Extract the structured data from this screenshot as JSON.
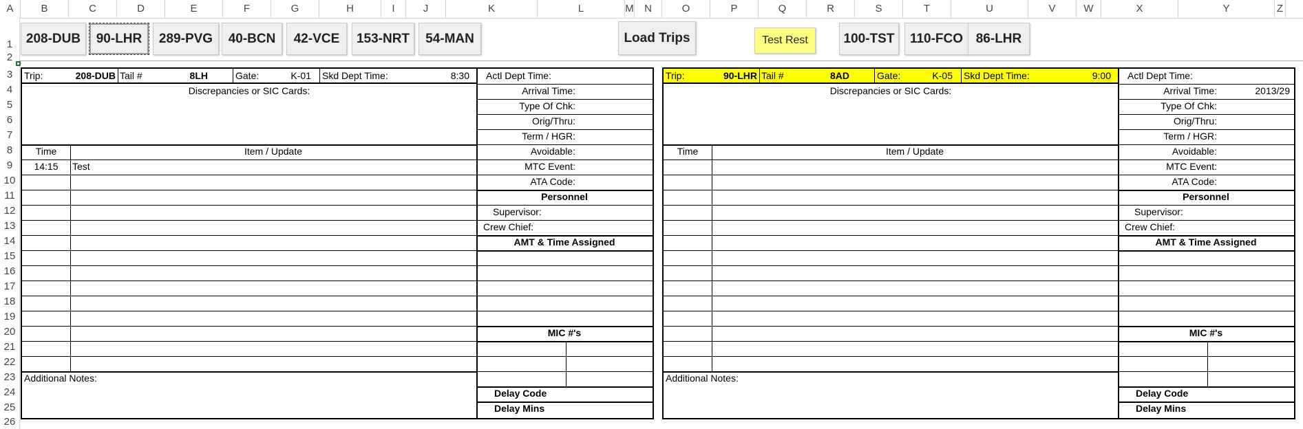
{
  "sheet": {
    "columns": [
      "A",
      "B",
      "C",
      "D",
      "E",
      "F",
      "G",
      "H",
      "I",
      "J",
      "K",
      "L",
      "M",
      "N",
      "O",
      "P",
      "Q",
      "R",
      "S",
      "T",
      "U",
      "V",
      "W",
      "X",
      "Y",
      "Z"
    ],
    "rows": [
      "1",
      "2",
      "3",
      "4",
      "5",
      "6",
      "7",
      "8",
      "9",
      "10",
      "11",
      "12",
      "13",
      "14",
      "15",
      "16",
      "17",
      "18",
      "19",
      "20",
      "21",
      "22",
      "23",
      "24",
      "25",
      "26"
    ]
  },
  "buttons": {
    "b1": "208-DUB",
    "b2": "90-LHR",
    "b3": "289-PVG",
    "b4": "40-BCN",
    "b5": "42-VCE",
    "b6": "153-NRT",
    "b7": "54-MAN",
    "load": "Load Trips",
    "test": "Test Rest",
    "b8": "100-TST",
    "b9": "110-FCO",
    "b10": "86-LHR"
  },
  "colors": {
    "highlight": "#ffff00",
    "grid": "#d4d4d4",
    "excel_green": "#217346"
  },
  "left": {
    "trip_label": "Trip:",
    "trip": "208-DUB",
    "tail_label": "Tail #",
    "tail": "8LH",
    "gate_label": "Gate:",
    "gate": "K-01",
    "skd_label": "Skd Dept Time:",
    "skd": "8:30",
    "actl_label": "Actl Dept Time:",
    "arrival_label": "Arrival Time:",
    "arrival": "",
    "type_label": "Type Of Chk:",
    "orig_label": "Orig/Thru:",
    "term_label": "Term / HGR:",
    "avoid_label": "Avoidable:",
    "mtc_label": "MTC Event:",
    "ata_label": "ATA Code:",
    "personnel": "Personnel",
    "supervisor_label": "Supervisor:",
    "crew_label": "Crew Chief:",
    "amt": "AMT & Time Assigned",
    "mic": "MIC #'s",
    "delay_code": "Delay Code",
    "delay_mins": "Delay Mins",
    "disc": "Discrepancies or SIC Cards:",
    "time_h": "Time",
    "item_h": "Item / Update",
    "entry_time": "14:15",
    "entry_item": "Test",
    "notes": "Additional Notes:"
  },
  "right": {
    "trip_label": "Trip:",
    "trip": "90-LHR",
    "tail_label": "Tail #",
    "tail": "8AD",
    "gate_label": "Gate:",
    "gate": "K-05",
    "skd_label": "Skd Dept Time:",
    "skd": "9:00",
    "actl_label": "Actl Dept Time:",
    "arrival_label": "Arrival Time:",
    "arrival": "2013/29",
    "type_label": "Type Of Chk:",
    "orig_label": "Orig/Thru:",
    "term_label": "Term / HGR:",
    "avoid_label": "Avoidable:",
    "mtc_label": "MTC Event:",
    "ata_label": "ATA Code:",
    "personnel": "Personnel",
    "supervisor_label": "Supervisor:",
    "crew_label": "Crew Chief:",
    "amt": "AMT & Time Assigned",
    "mic": "MIC #'s",
    "delay_code": "Delay Code",
    "delay_mins": "Delay Mins",
    "disc": "Discrepancies or SIC Cards:",
    "time_h": "Time",
    "item_h": "Item / Update",
    "entry_time": "",
    "entry_item": "",
    "notes": "Additional Notes:"
  }
}
